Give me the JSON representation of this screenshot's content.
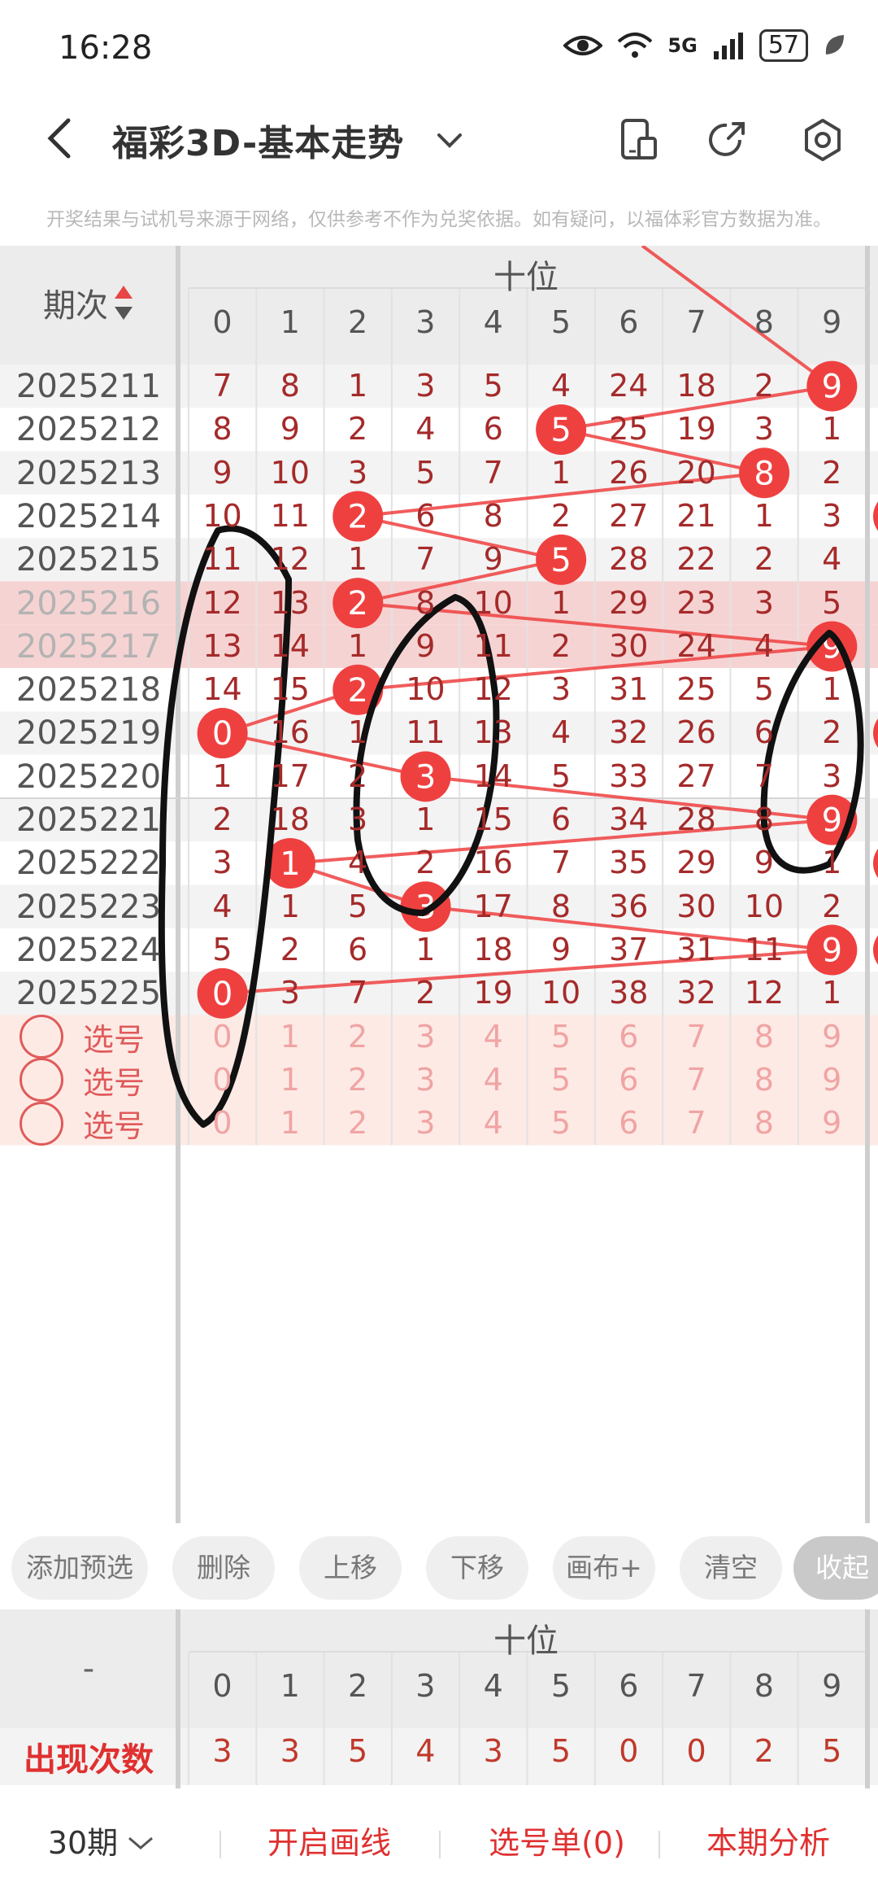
{
  "status": {
    "time": "16:28",
    "network": "5G",
    "battery": "57"
  },
  "header": {
    "title": "福彩3D-基本走势"
  },
  "disclaimer": "开奖结果与试机号来源于网络，仅供参考不作为兑奖依据。如有疑问，以福体彩官方数据为准。",
  "table": {
    "section_title": "十位",
    "issue_header": "期次",
    "digits": [
      "0",
      "1",
      "2",
      "3",
      "4",
      "5",
      "6",
      "7",
      "8",
      "9"
    ],
    "rows": [
      {
        "issue": "2025211",
        "cells": [
          "7",
          "8",
          "1",
          "3",
          "5",
          "4",
          "24",
          "18",
          "2",
          "9"
        ],
        "hit": 9
      },
      {
        "issue": "2025212",
        "cells": [
          "8",
          "9",
          "2",
          "4",
          "6",
          "5",
          "25",
          "19",
          "3",
          "1"
        ],
        "hit": 5
      },
      {
        "issue": "2025213",
        "cells": [
          "9",
          "10",
          "3",
          "5",
          "7",
          "1",
          "26",
          "20",
          "8",
          "2"
        ],
        "hit": 8
      },
      {
        "issue": "2025214",
        "cells": [
          "10",
          "11",
          "2",
          "6",
          "8",
          "2",
          "27",
          "21",
          "1",
          "3"
        ],
        "hit": 2
      },
      {
        "issue": "2025215",
        "cells": [
          "11",
          "12",
          "1",
          "7",
          "9",
          "5",
          "28",
          "22",
          "2",
          "4"
        ],
        "hit": 5
      },
      {
        "issue": "2025216",
        "cells": [
          "12",
          "13",
          "2",
          "8",
          "10",
          "1",
          "29",
          "23",
          "3",
          "5"
        ],
        "hit": 2
      },
      {
        "issue": "2025217",
        "cells": [
          "13",
          "14",
          "1",
          "9",
          "11",
          "2",
          "30",
          "24",
          "4",
          "9"
        ],
        "hit": 9
      },
      {
        "issue": "2025218",
        "cells": [
          "14",
          "15",
          "2",
          "10",
          "12",
          "3",
          "31",
          "25",
          "5",
          "1"
        ],
        "hit": 2
      },
      {
        "issue": "2025219",
        "cells": [
          "0",
          "16",
          "1",
          "11",
          "13",
          "4",
          "32",
          "26",
          "6",
          "2"
        ],
        "hit": 0
      },
      {
        "issue": "2025220",
        "cells": [
          "1",
          "17",
          "2",
          "3",
          "14",
          "5",
          "33",
          "27",
          "7",
          "3"
        ],
        "hit": 3
      },
      {
        "issue": "2025221",
        "cells": [
          "2",
          "18",
          "3",
          "1",
          "15",
          "6",
          "34",
          "28",
          "8",
          "9"
        ],
        "hit": 9
      },
      {
        "issue": "2025222",
        "cells": [
          "3",
          "1",
          "4",
          "2",
          "16",
          "7",
          "35",
          "29",
          "9",
          "1"
        ],
        "hit": 1
      },
      {
        "issue": "2025223",
        "cells": [
          "4",
          "1",
          "5",
          "3",
          "17",
          "8",
          "36",
          "30",
          "10",
          "2"
        ],
        "hit": 3
      },
      {
        "issue": "2025224",
        "cells": [
          "5",
          "2",
          "6",
          "1",
          "18",
          "9",
          "37",
          "31",
          "11",
          "9"
        ],
        "hit": 9
      },
      {
        "issue": "2025225",
        "cells": [
          "0",
          "3",
          "7",
          "2",
          "19",
          "10",
          "38",
          "32",
          "12",
          "1"
        ],
        "hit": 0
      }
    ],
    "pick_label": "选号",
    "pick_rows": 3
  },
  "toolbar": {
    "buttons": [
      "添加预选",
      "删除",
      "上移",
      "下移",
      "画布+",
      "清空",
      "收起"
    ]
  },
  "stats": {
    "dash": "-",
    "section_title": "十位",
    "row_label": "出现次数",
    "values": [
      "3",
      "3",
      "5",
      "4",
      "3",
      "5",
      "0",
      "0",
      "2",
      "5"
    ]
  },
  "bottom_bar": {
    "period": "30期",
    "draw_line": "开启画线",
    "pick_list": "选号单(0)",
    "analysis": "本期分析"
  },
  "colors": {
    "accent": "#e84545",
    "ball": "#ef4040",
    "highlight_row": "#f6d3d3",
    "pick_bg": "#fdeae5"
  }
}
